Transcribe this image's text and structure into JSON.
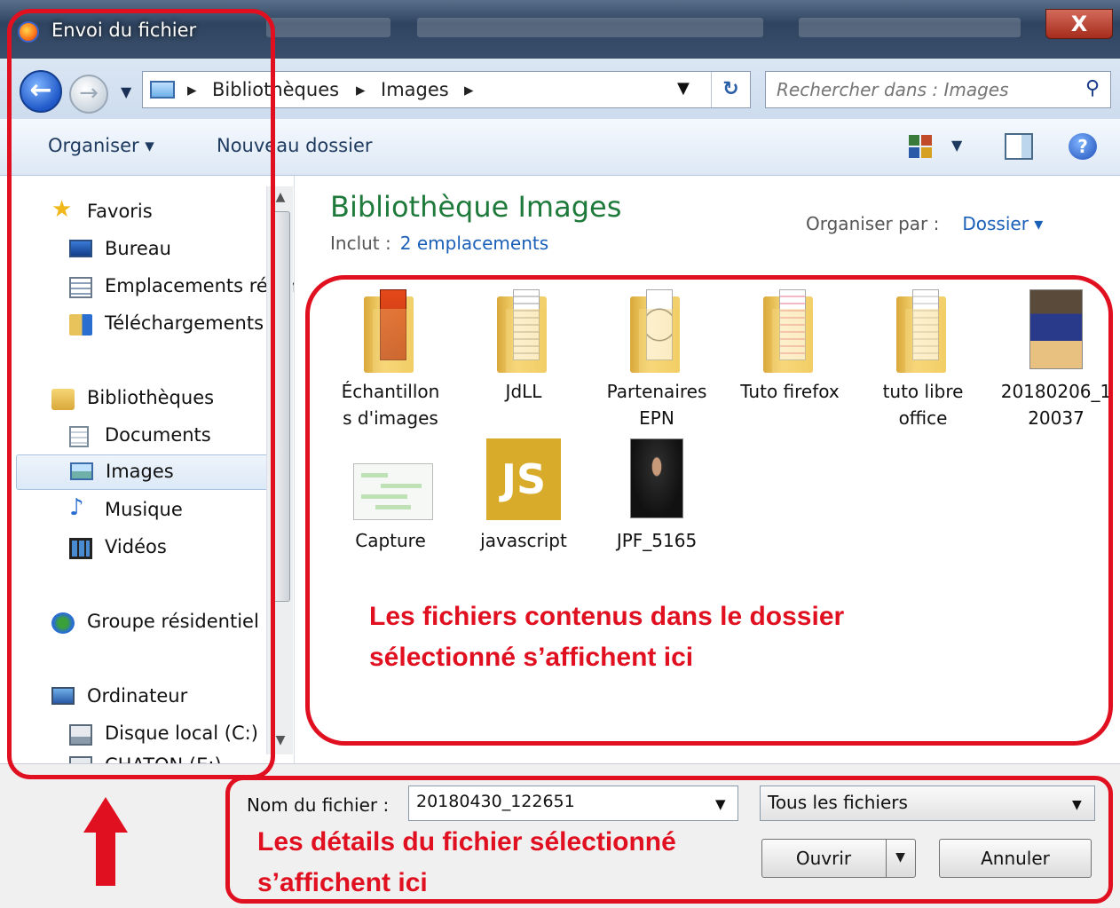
{
  "window": {
    "title": "Envoi du fichier",
    "close_label": "X"
  },
  "addressbar": {
    "back_icon": "arrow-left-icon",
    "forward_icon": "arrow-right-icon",
    "breadcrumbs": [
      "Bibliothèques",
      "Images"
    ],
    "separator": "▸",
    "search_placeholder": "Rechercher dans : Images"
  },
  "toolbar": {
    "organize": "Organiser ▾",
    "new_folder": "Nouveau dossier"
  },
  "sidebar": {
    "favorites": {
      "label": "Favoris",
      "items": [
        "Bureau",
        "Emplacements récents",
        "Téléchargements"
      ]
    },
    "libraries": {
      "label": "Bibliothèques",
      "items": [
        "Documents",
        "Images",
        "Musique",
        "Vidéos"
      ],
      "selected": "Images"
    },
    "homegroup": "Groupe résidentiel",
    "computer": {
      "label": "Ordinateur",
      "items": [
        "Disque local (C:)",
        "CHATON (E:)"
      ]
    }
  },
  "content": {
    "title": "Bibliothèque Images",
    "includes_label": "Inclut :",
    "includes_link": "2 emplacements",
    "arrange_label": "Organiser par :",
    "arrange_value": "Dossier ▾",
    "files": [
      {
        "name": "Échantillons d'images",
        "line1": "Échantillon",
        "line2": "s d'images",
        "type": "folder"
      },
      {
        "name": "JdLL",
        "line1": "JdLL",
        "line2": "",
        "type": "folder"
      },
      {
        "name": "Partenaires EPN",
        "line1": "Partenaires",
        "line2": "EPN",
        "type": "folder"
      },
      {
        "name": "Tuto firefox",
        "line1": "Tuto firefox",
        "line2": "",
        "type": "folder"
      },
      {
        "name": "tuto libre office",
        "line1": "tuto libre",
        "line2": "office",
        "type": "folder"
      },
      {
        "name": "20180206_120037",
        "line1": "20180206_1",
        "line2": "20037",
        "type": "image"
      },
      {
        "name": "Capture",
        "line1": "Capture",
        "line2": "",
        "type": "image"
      },
      {
        "name": "javascript",
        "line1": "javascript",
        "line2": "",
        "type": "image",
        "thumb_text": "JS"
      },
      {
        "name": "JPF_5165",
        "line1": "JPF_5165",
        "line2": "",
        "type": "image"
      }
    ]
  },
  "bottom": {
    "filename_label": "Nom du fichier :",
    "filename_value": "20180430_122651",
    "filetype_value": "Tous les fichiers",
    "open_button": "Ouvrir",
    "cancel_button": "Annuler"
  },
  "annotations": {
    "content_line1": "Les fichiers contenus dans le dossier",
    "content_line2": "sélectionné s’affichent ici",
    "bottom_line1": "Les détails du fichier sélectionné",
    "bottom_line2": "s’affichent ici",
    "color": "#e01020"
  },
  "colors": {
    "accent_title": "#1e7a3a",
    "link": "#1a5fb8"
  }
}
